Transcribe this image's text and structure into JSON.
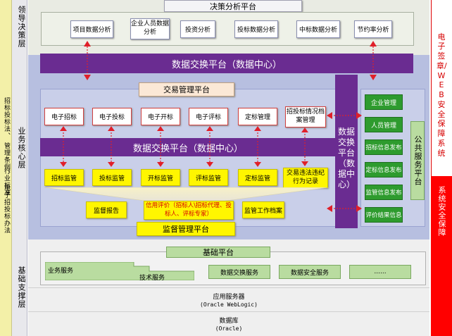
{
  "layers": {
    "leadership": "领导决策层",
    "business_core": "业务核心层",
    "infrastructure": "基础支撑层"
  },
  "laws": {
    "col1": "招标投标法、",
    "col2": "行业标准",
    "col3": "管理条例、",
    "col4": "电子招投标办法"
  },
  "decision": {
    "title": "决策分析平台",
    "items": [
      "项目数据分析",
      "企业人员数据分析",
      "投资分析",
      "投标数据分析",
      "中标数据分析",
      "节约率分析"
    ]
  },
  "data_exchange_top": "数据交换平台（数据中心）",
  "data_exchange_mid": "数据交换平台（数据中心）",
  "data_exchange_vertical": "数据交换平台（数据中心）",
  "trading": {
    "title": "交易管理平台",
    "items": [
      "电子招标",
      "电子投标",
      "电子开标",
      "电子评标",
      "定标管理",
      "招投标情况档案管理"
    ]
  },
  "supervision": {
    "items": [
      "招标监管",
      "投标监管",
      "开标监管",
      "评标监管",
      "定标监管",
      "交易违法违纪行为记录"
    ],
    "report": "监督报告",
    "credit": "信用评价（招标人\\招标代理、投标人、评标专家）",
    "archive": "监管工作档案",
    "title": "监督管理平台"
  },
  "public_service": {
    "title": "公共服务平台",
    "items": [
      "企业管理",
      "人员管理",
      "招标信息发布",
      "定标信息发布",
      "监管信息发布",
      "评价结果信息"
    ]
  },
  "right_bars": {
    "esign": "电子签章/WEB安全保障系统",
    "security": "系统安全保障"
  },
  "base": {
    "title": "基础平台",
    "business_service": "业务服务",
    "tech_service": "技术服务",
    "exchange_service": "数据交换服务",
    "security_service": "数据安全服务",
    "ellipsis": "......"
  },
  "app_server": {
    "title": "应用服务器",
    "sub": "(Oracle WebLogic)"
  },
  "database": {
    "title": "数据库",
    "sub": "(Oracle)"
  },
  "colors": {
    "purple": "#6a2c91",
    "green": "#2e9b2e",
    "yellow": "#fff600",
    "red": "#ff0000"
  }
}
